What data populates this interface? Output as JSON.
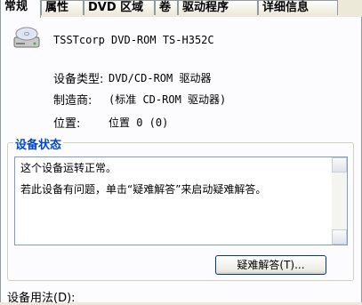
{
  "tabs": [
    {
      "label": "常规",
      "active": true
    },
    {
      "label": "属性",
      "active": false
    },
    {
      "label": "DVD 区域",
      "active": false
    },
    {
      "label": "卷",
      "active": false
    },
    {
      "label": "驱动程序",
      "active": false
    },
    {
      "label": "详细信息",
      "active": false
    }
  ],
  "device": {
    "name": "TSSTcorp DVD-ROM TS-H352C",
    "icon": "cd-drive-icon"
  },
  "properties": {
    "type_label": "设备类型:",
    "type_value": "DVD/CD-ROM 驱动器",
    "manufacturer_label": "制造商:",
    "manufacturer_value": "(标准 CD-ROM 驱动器)",
    "location_label": "位置:",
    "location_value": "位置 0 (0)"
  },
  "status": {
    "group_title": "设备状态",
    "line1": "这个设备运转正常。",
    "line2": "若此设备有问题，单击“疑难解答”来启动疑难解答。",
    "troubleshoot_button": "疑难解答(T)..."
  },
  "usage": {
    "label": "设备用法(D):"
  },
  "colors": {
    "background": "#ece9d8",
    "panel": "#fcfcfe",
    "group_title": "#0046d5",
    "active_tab_highlight": "#ffc83c"
  }
}
